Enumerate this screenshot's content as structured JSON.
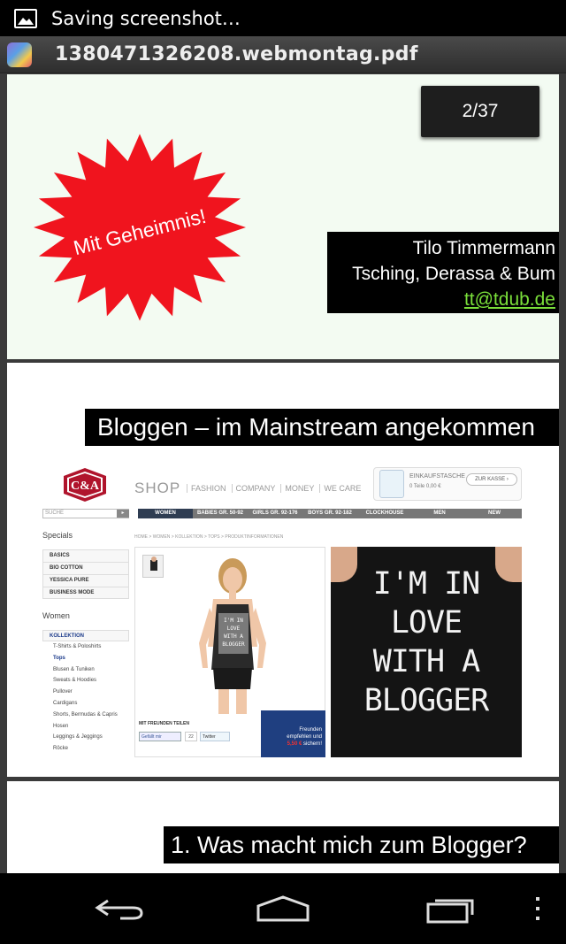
{
  "status_bar": {
    "notification_text": "Saving screenshot…",
    "icon": "image-icon"
  },
  "action_bar": {
    "title": "1380471326208.webmontag.pdf",
    "app_icon": "pdf-viewer-app-icon"
  },
  "page_indicator": "2/37",
  "slide1": {
    "starburst_text": "Mit Geheimnis!",
    "starburst_color": "#f0141e",
    "author_name": "Tilo Timmermann",
    "author_company": "Tsching, Derassa & Bum",
    "author_email": "tt@tdub.de",
    "email_color": "#7adf3a"
  },
  "slide2": {
    "heading": "Bloggen – im Mainstream angekommen",
    "shop": {
      "logo_text": "C&A",
      "shop_label": "SHOP",
      "top_nav": [
        "FASHION",
        "COMPANY",
        "MONEY",
        "WE CARE"
      ],
      "cart_title": "EINKAUFSTASCHE",
      "cart_meta": "0 Teile   0,00 €",
      "checkout_label": "ZUR KASSE ›",
      "search_placeholder": "SUCHE",
      "categories": [
        "WOMEN",
        "BABIES GR. 50-92",
        "GIRLS GR. 92-176",
        "BOYS GR. 92-182",
        "CLOCKHOUSE",
        "MEN",
        "NEW"
      ],
      "specials_label": "Specials",
      "breadcrumb": "HOME > WOMEN > KOLLEKTION > TOPS > PRODUKTINFORMATIONEN",
      "specials_menu": [
        "BASICS",
        "BIO COTTON",
        "YESSICA PURE",
        "BUSINESS MODE"
      ],
      "women_label": "Women",
      "collection_head": "KOLLEKTION",
      "collection_items": [
        "T-Shirts & Poloshirts",
        "Tops",
        "Blusen & Tuniken",
        "Sweats & Hoodies",
        "Pullover",
        "Cardigans",
        "Shorts, Bermudas & Capris",
        "Hosen",
        "Leggings & Jeggings",
        "Röcke"
      ],
      "share_label": "MIT FREUNDEN TEILEN",
      "fb_label": "Gefällt mir",
      "fb_count": "22",
      "twitter_label": "Twitter",
      "promo_line1": "Freunden",
      "promo_line2": "empfehlen und",
      "promo_price": "5,50 €",
      "promo_line3": "sichern!",
      "shirt_lines": [
        "I'M IN",
        "LOVE",
        "WITH A",
        "BLOGGER"
      ]
    }
  },
  "slide3": {
    "heading": "1. Was macht mich zum Blogger?"
  },
  "nav_bar": {
    "back": "back-icon",
    "home": "home-icon",
    "recents": "recent-apps-icon",
    "menu": "overflow-menu-icon"
  }
}
